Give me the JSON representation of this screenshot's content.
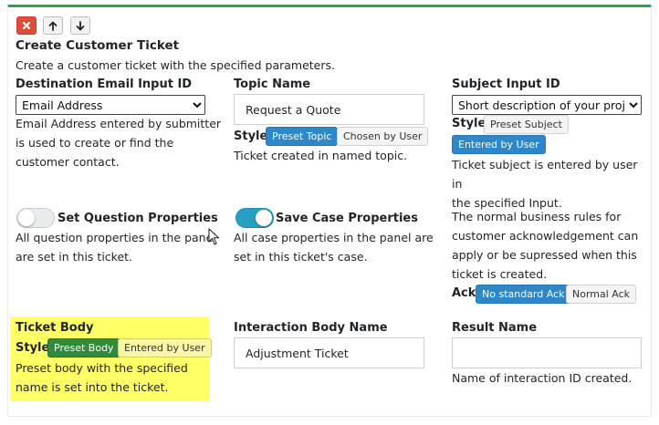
{
  "panel": {
    "title": "Create Customer Ticket",
    "description": "Create a customer ticket with the specified parameters."
  },
  "toolbar": {
    "close_icon": "close-icon",
    "up_icon": "arrow-up-icon",
    "down_icon": "arrow-down-icon"
  },
  "destination_email": {
    "label": "Destination Email Input ID",
    "selected": "Email Address",
    "help_lines": [
      "Email Address entered by submitter",
      "is used to create or find the",
      "customer contact."
    ]
  },
  "topic": {
    "label": "Topic Name",
    "value": "Request a Quote",
    "style_label": "Style",
    "style_options": [
      "Preset Topic",
      "Chosen by User"
    ],
    "help": "Ticket created in named topic."
  },
  "subject": {
    "label": "Subject Input ID",
    "selected": "Short description of your project",
    "style_label": "Style",
    "style_options": [
      "Preset Subject",
      "Entered by User"
    ],
    "help_lines": [
      "Ticket subject is entered by user in",
      "the specified Input."
    ]
  },
  "question_props": {
    "label": "Set Question Properties",
    "enabled": false,
    "help_lines": [
      "All question properties in the panel",
      "are set in this ticket."
    ]
  },
  "case_props": {
    "label": "Save Case Properties",
    "enabled": true,
    "help_lines": [
      "All case properties in the panel are",
      "set in this ticket's case."
    ]
  },
  "ack": {
    "help_lines": [
      "The normal business rules for",
      "customer acknowledgement can",
      "apply or be supressed when this",
      "ticket is created."
    ],
    "label": "Ack",
    "options": [
      "No standard Ack",
      "Normal Ack"
    ]
  },
  "ticket_body": {
    "label": "Ticket Body",
    "style_label": "Style",
    "style_options": [
      "Preset Body",
      "Entered by User"
    ],
    "help_lines": [
      "Preset body with the specified",
      "name is set into the ticket."
    ],
    "highlight_color": "#ffff66"
  },
  "interaction_body": {
    "label": "Interaction Body Name",
    "value": "Adjustment Ticket"
  },
  "result": {
    "label": "Result Name",
    "value": "",
    "help": "Name of interaction ID created."
  },
  "colors": {
    "accent_green": "#28a745",
    "blue": "#2e87c9",
    "close_red": "#e04c3a",
    "toggle_on": "#28a0c2"
  }
}
